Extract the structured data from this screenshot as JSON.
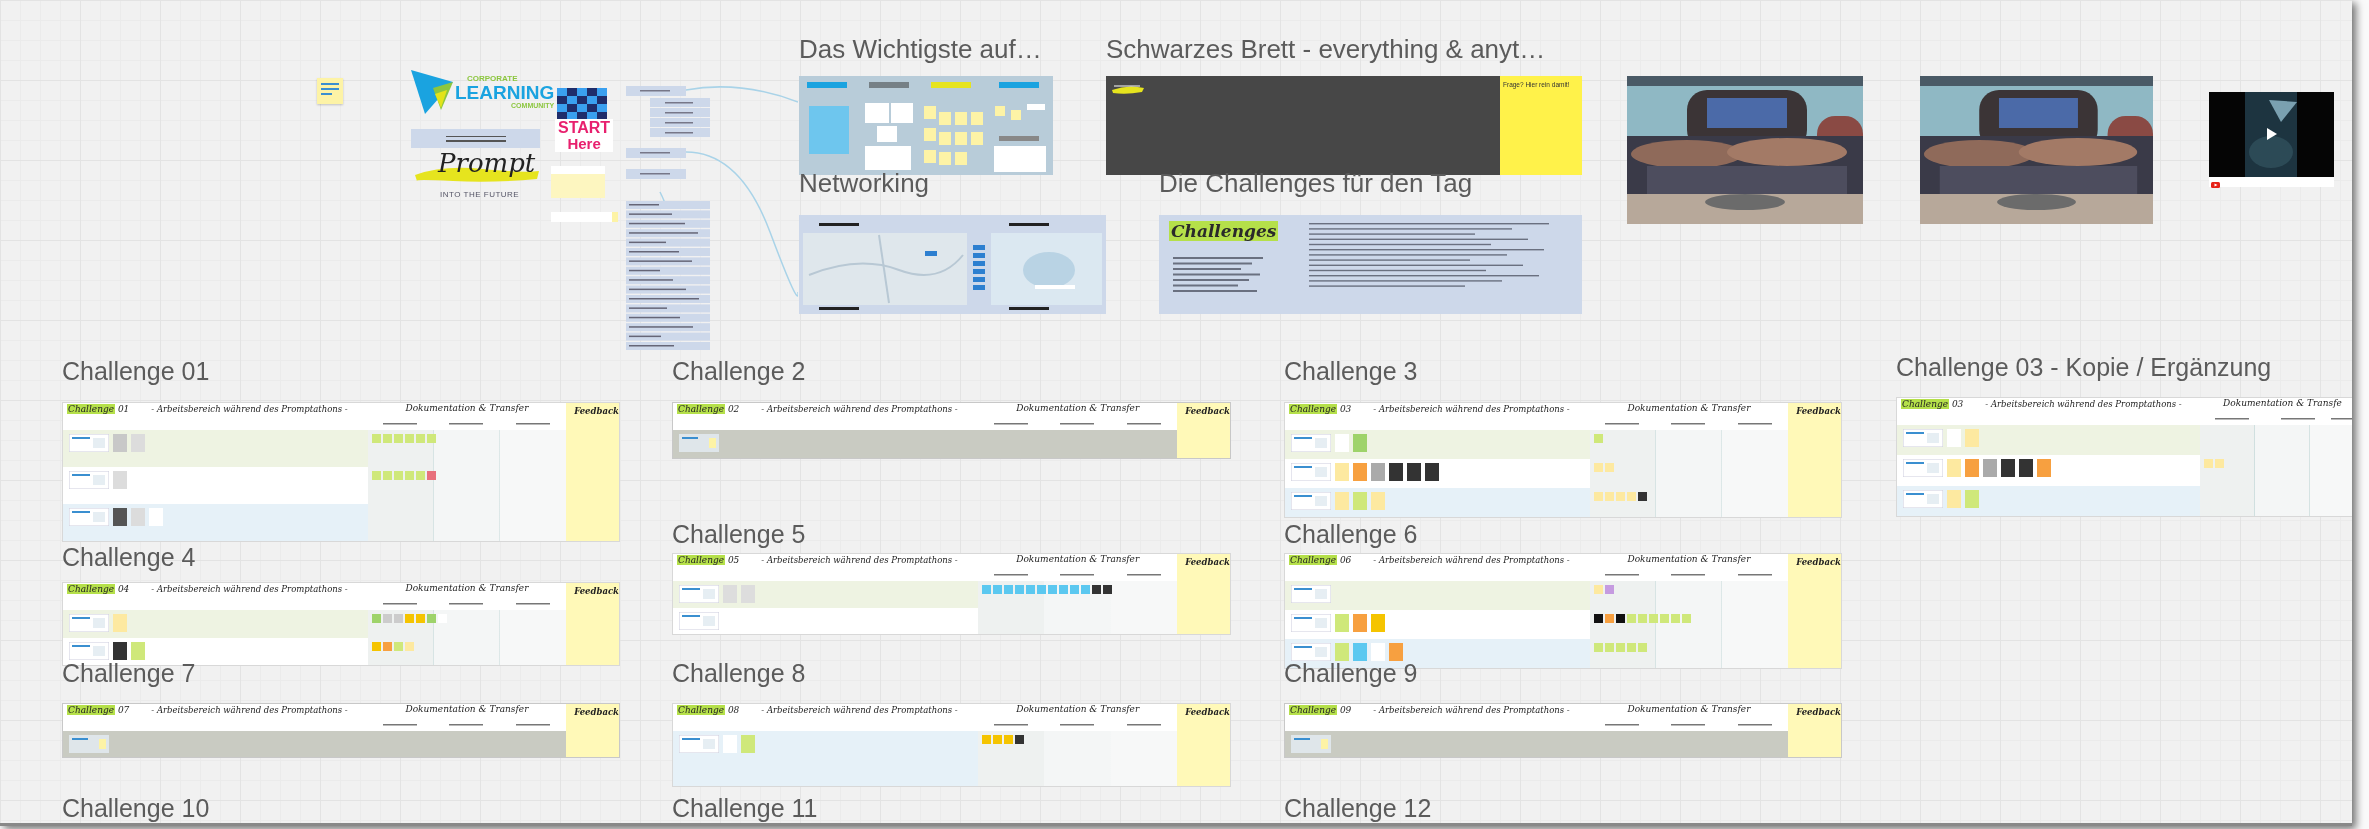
{
  "logo": {
    "line1": "CORPORATE",
    "line2": "LEARNING",
    "line3": "COMMUNITY"
  },
  "prompt_logo": {
    "title": "Prompt",
    "tagline": "INTO THE FUTURE"
  },
  "start_flag": {
    "line1": "START",
    "line2": "Here"
  },
  "sections": [
    {
      "kind": "overview",
      "title": "Das Wichtigste auf…"
    },
    {
      "kind": "pinboard",
      "title": "Schwarzes Brett - everything & anyt…",
      "note": "Frage? Hier rein damit!"
    },
    {
      "kind": "networking",
      "title": "Networking"
    },
    {
      "kind": "challenges",
      "title": "Die Challenges für den Tag",
      "heading": "Challenges"
    }
  ],
  "photos": [
    {
      "kind": "picture"
    },
    {
      "kind": "picture"
    }
  ],
  "video": {
    "kind": "picture"
  },
  "challenges": [
    {
      "title": "Challenge 01",
      "logo": "Challenge",
      "number": "01",
      "subtitle": "- Arbeitsbereich während des Promptathons -",
      "doc_heading": "Dokumentation & Transfer",
      "feedback": "Feedback",
      "collapsed": false,
      "lanes": [
        {
          "color": "#eef3e2",
          "cards": [
            {
              "color": "#c8c8c8"
            },
            {
              "color": "#dcdcdc"
            }
          ],
          "stickies": [
            {
              "color": "#cfe87a"
            },
            {
              "color": "#cfe87a"
            },
            {
              "color": "#cfe87a"
            },
            {
              "color": "#cfe87a"
            },
            {
              "color": "#cfe87a"
            },
            {
              "color": "#cfe87a"
            }
          ]
        },
        {
          "color": "#ffffff",
          "cards": [
            {
              "color": "#dcdcdc"
            }
          ],
          "stickies": [
            {
              "color": "#cfe87a"
            },
            {
              "color": "#cfe87a"
            },
            {
              "color": "#cfe87a"
            },
            {
              "color": "#cfe87a"
            },
            {
              "color": "#cfe87a"
            },
            {
              "color": "#e8707c"
            }
          ]
        },
        {
          "color": "#e6f1f8",
          "cards": [
            {
              "color": "#555555"
            },
            {
              "color": "#dcdcdc"
            },
            {
              "color": "#ffffff"
            }
          ]
        }
      ]
    },
    {
      "title": "Challenge 2",
      "logo": "Challenge",
      "number": "02",
      "subtitle": "- Arbeitsbereich während des Promptathons -",
      "doc_heading": "Dokumentation & Transfer",
      "feedback": "Feedback",
      "collapsed": true
    },
    {
      "title": "Challenge 3",
      "logo": "Challenge",
      "number": "03",
      "subtitle": "- Arbeitsbereich während des Promptathons -",
      "doc_heading": "Dokumentation & Transfer",
      "feedback": "Feedback",
      "collapsed": false,
      "lanes": [
        {
          "color": "#eef3e2",
          "cards": [
            {
              "color": "#ffffff"
            },
            {
              "color": "#9ed36a"
            }
          ],
          "stickies": [
            {
              "color": "#cfe87a"
            }
          ]
        },
        {
          "color": "#ffffff",
          "cards": [
            {
              "color": "#fde9a0"
            },
            {
              "color": "#f7a040"
            },
            {
              "color": "#aaaaaa"
            },
            {
              "color": "#333333"
            },
            {
              "color": "#333333"
            },
            {
              "color": "#333333"
            }
          ],
          "stickies": [
            {
              "color": "#fde9a0"
            },
            {
              "color": "#fde9a0"
            }
          ]
        },
        {
          "color": "#e6f1f8",
          "cards": [
            {
              "color": "#fde9a0"
            },
            {
              "color": "#cfe87a"
            },
            {
              "color": "#fde9a0"
            }
          ],
          "stickies": [
            {
              "color": "#fde9a0"
            },
            {
              "color": "#fde9a0"
            },
            {
              "color": "#fde9a0"
            },
            {
              "color": "#fde9a0"
            },
            {
              "color": "#333333"
            }
          ]
        }
      ]
    },
    {
      "title": "Challenge 03 - Kopie / Ergänzung",
      "logo": "Challenge",
      "number": "03",
      "subtitle": "- Arbeitsbereich während des Promptathons -",
      "doc_heading": "Dokumentation & Transfe",
      "collapsed": false,
      "lanes": [
        {
          "color": "#eef3e2",
          "cards": [
            {
              "color": "#ffffff"
            },
            {
              "color": "#fde9a0"
            }
          ]
        },
        {
          "color": "#ffffff",
          "cards": [
            {
              "color": "#fde9a0"
            },
            {
              "color": "#f7a040"
            },
            {
              "color": "#aaaaaa"
            },
            {
              "color": "#333333"
            },
            {
              "color": "#333333"
            },
            {
              "color": "#f7a040"
            }
          ],
          "stickies": [
            {
              "color": "#fde9a0"
            },
            {
              "color": "#fde9a0"
            }
          ]
        },
        {
          "color": "#e6f1f8",
          "cards": [
            {
              "color": "#fde9a0"
            },
            {
              "color": "#cfe87a"
            }
          ]
        }
      ]
    },
    {
      "title": "Challenge 4",
      "logo": "Challenge",
      "number": "04",
      "subtitle": "- Arbeitsbereich während des Promptathons -",
      "doc_heading": "Dokumentation & Transfer",
      "feedback": "Feedback",
      "collapsed": false,
      "lanes": [
        {
          "color": "#eef3e2",
          "cards": [
            {
              "color": "#fde9a0"
            }
          ],
          "stickies": [
            {
              "color": "#9ed36a"
            },
            {
              "color": "#cccccc"
            },
            {
              "color": "#cccccc"
            },
            {
              "color": "#f5c400"
            },
            {
              "color": "#f5c400"
            },
            {
              "color": "#9ed36a"
            },
            {
              "color": "#ffffff"
            }
          ]
        },
        {
          "color": "#ffffff",
          "cards": [
            {
              "color": "#333333"
            },
            {
              "color": "#cfe87a"
            }
          ],
          "stickies": [
            {
              "color": "#f5c400"
            },
            {
              "color": "#f7a040"
            },
            {
              "color": "#cfe87a"
            },
            {
              "color": "#fde9a0"
            }
          ]
        }
      ]
    },
    {
      "title": "Challenge 5",
      "logo": "Challenge",
      "number": "05",
      "subtitle": "- Arbeitsbereich während des Promptathons -",
      "doc_heading": "Dokumentation & Transfer",
      "feedback": "Feedback",
      "collapsed": false,
      "lanes": [
        {
          "color": "#eef3e2",
          "cards": [
            {
              "color": "#dddddd"
            },
            {
              "color": "#dddddd"
            }
          ],
          "stickies": [
            {
              "color": "#5bc8f0"
            },
            {
              "color": "#5bc8f0"
            },
            {
              "color": "#5bc8f0"
            },
            {
              "color": "#5bc8f0"
            },
            {
              "color": "#5bc8f0"
            },
            {
              "color": "#5bc8f0"
            },
            {
              "color": "#5bc8f0"
            },
            {
              "color": "#5bc8f0"
            },
            {
              "color": "#5bc8f0"
            },
            {
              "color": "#5bc8f0"
            },
            {
              "color": "#333333"
            },
            {
              "color": "#333333"
            }
          ]
        },
        {
          "color": "#ffffff"
        }
      ]
    },
    {
      "title": "Challenge 6",
      "logo": "Challenge",
      "number": "06",
      "subtitle": "- Arbeitsbereich während des Promptathons -",
      "doc_heading": "Dokumentation & Transfer",
      "feedback": "Feedback",
      "collapsed": false,
      "lanes": [
        {
          "color": "#eef3e2",
          "stickies": [
            {
              "color": "#fde9a0"
            },
            {
              "color": "#c59be0"
            }
          ]
        },
        {
          "color": "#ffffff",
          "cards": [
            {
              "color": "#cfe87a"
            },
            {
              "color": "#f7a040"
            },
            {
              "color": "#f5c400"
            }
          ],
          "stickies": [
            {
              "color": "#111111"
            },
            {
              "color": "#f7a040"
            },
            {
              "color": "#111111"
            },
            {
              "color": "#cfe87a"
            },
            {
              "color": "#cfe87a"
            },
            {
              "color": "#cfe87a"
            },
            {
              "color": "#cfe87a"
            },
            {
              "color": "#cfe87a"
            },
            {
              "color": "#cfe87a"
            }
          ]
        },
        {
          "color": "#e6f1f8",
          "cards": [
            {
              "color": "#cfe87a"
            },
            {
              "color": "#5bc8f0"
            },
            {
              "color": "#ffffff"
            },
            {
              "color": "#f7a040"
            }
          ],
          "stickies": [
            {
              "color": "#cfe87a"
            },
            {
              "color": "#cfe87a"
            },
            {
              "color": "#cfe87a"
            },
            {
              "color": "#cfe87a"
            },
            {
              "color": "#cfe87a"
            }
          ]
        }
      ]
    },
    {
      "title": "Challenge 7",
      "logo": "Challenge",
      "number": "07",
      "subtitle": "- Arbeitsbereich während des Promptathons -",
      "doc_heading": "Dokumentation & Transfer",
      "feedback": "Feedback",
      "collapsed": true
    },
    {
      "title": "Challenge 8",
      "logo": "Challenge",
      "number": "08",
      "subtitle": "- Arbeitsbereich während des Promptathons -",
      "doc_heading": "Dokumentation & Transfer",
      "feedback": "Feedback",
      "collapsed": false,
      "lanes": [
        {
          "color": "#e6f1f8",
          "cards": [
            {
              "color": "#ffffff"
            },
            {
              "color": "#cfe87a"
            }
          ],
          "stickies": [
            {
              "color": "#f5c400"
            },
            {
              "color": "#f5c400"
            },
            {
              "color": "#f5c400"
            },
            {
              "color": "#333333"
            }
          ]
        }
      ]
    },
    {
      "title": "Challenge 9",
      "logo": "Challenge",
      "number": "09",
      "subtitle": "- Arbeitsbereich während des Promptathons -",
      "doc_heading": "Dokumentation & Transfer",
      "feedback": "Feedback",
      "collapsed": true
    }
  ],
  "more_titles": [
    "Challenge 10",
    "Challenge 11",
    "Challenge 12"
  ]
}
